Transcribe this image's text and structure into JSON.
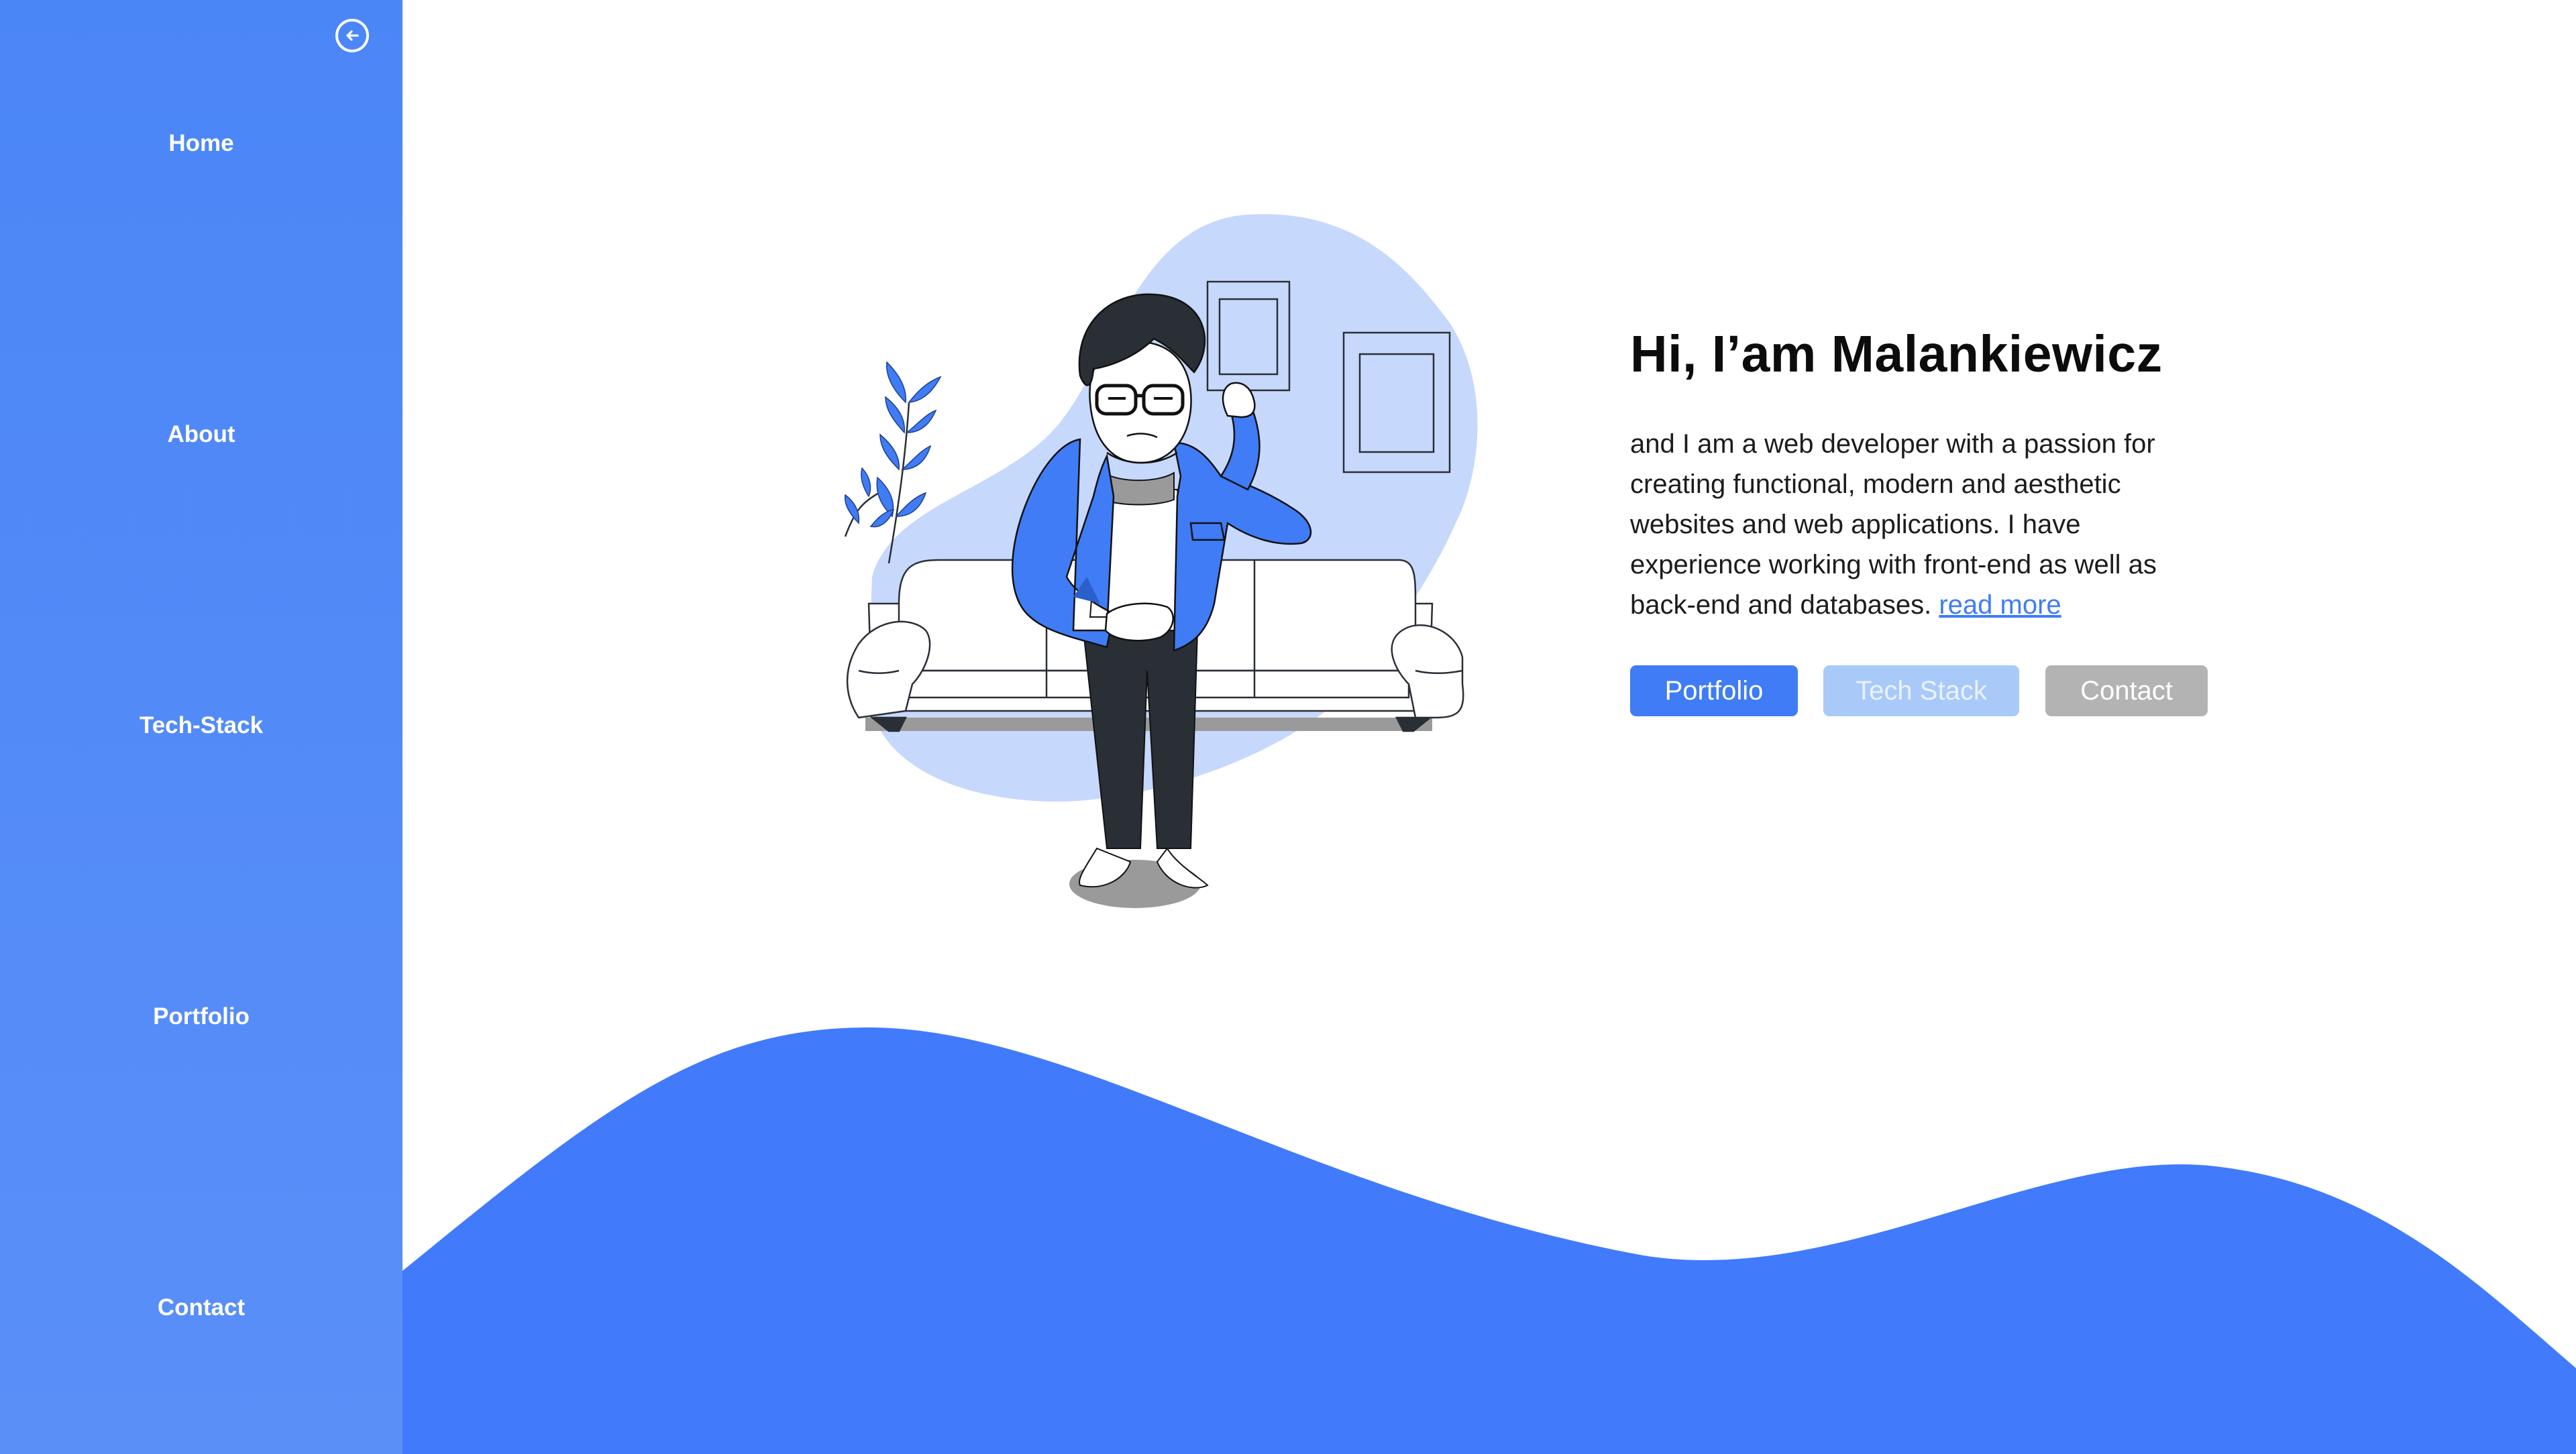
{
  "sidebar": {
    "back_icon": "arrow-left-circle-icon",
    "items": [
      {
        "label": "Home"
      },
      {
        "label": "About"
      },
      {
        "label": "Tech-Stack"
      },
      {
        "label": "Portfolio"
      },
      {
        "label": "Contact"
      }
    ]
  },
  "hero": {
    "title": "Hi, I’am Malankiewicz",
    "description": "and I am a web developer with a passion for creating functional, modern and aesthetic websites and web applications. I have experience working with front-end as well as back-end and databases.",
    "read_more": "read more",
    "buttons": {
      "portfolio": "Portfolio",
      "tech_stack": "Tech Stack",
      "contact": "Contact"
    }
  },
  "colors": {
    "sidebar": "#4b86f7",
    "accent": "#3f7cf6",
    "blob": "#c6d8fc",
    "wave": "#417bfb",
    "button_secondary": "#a9caf9",
    "button_muted": "#b3b3b3"
  }
}
